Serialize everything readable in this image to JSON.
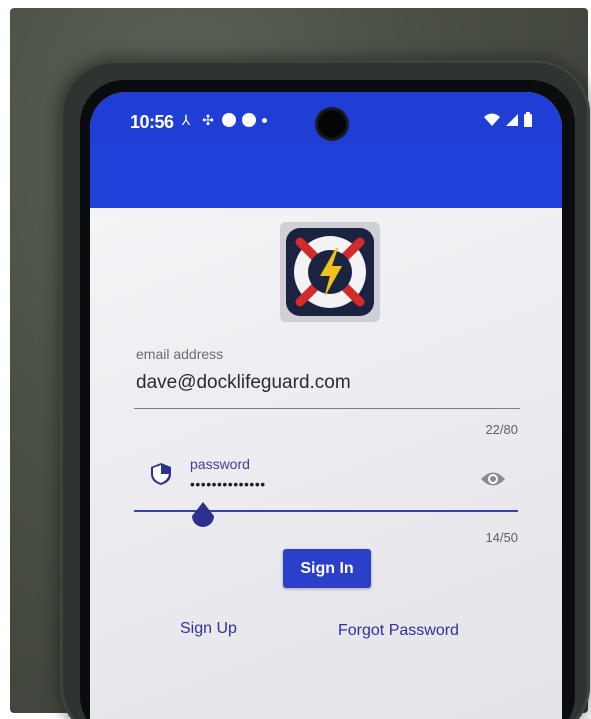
{
  "status_bar": {
    "time": "10:56",
    "accent": "#1f3ed6"
  },
  "app_bar": {
    "color": "#2040da"
  },
  "login_form": {
    "email": {
      "label": "email address",
      "value": "dave@docklifeguard.com",
      "counter": "22/80"
    },
    "password": {
      "label": "password",
      "value": "••••••••••••••",
      "counter": "14/50"
    },
    "sign_in_label": "Sign In",
    "sign_up_label": "Sign Up",
    "forgot_password_label": "Forgot Password"
  },
  "icons": {
    "shield": "shield-icon",
    "eye": "eye-icon",
    "logo": "lightning-bolt-icon"
  },
  "colors": {
    "primary": "#2b3fc8",
    "link": "#2f3398",
    "logo_red": "#d32a2a",
    "logo_navy": "#1a2340",
    "logo_yellow": "#f2c21a"
  }
}
